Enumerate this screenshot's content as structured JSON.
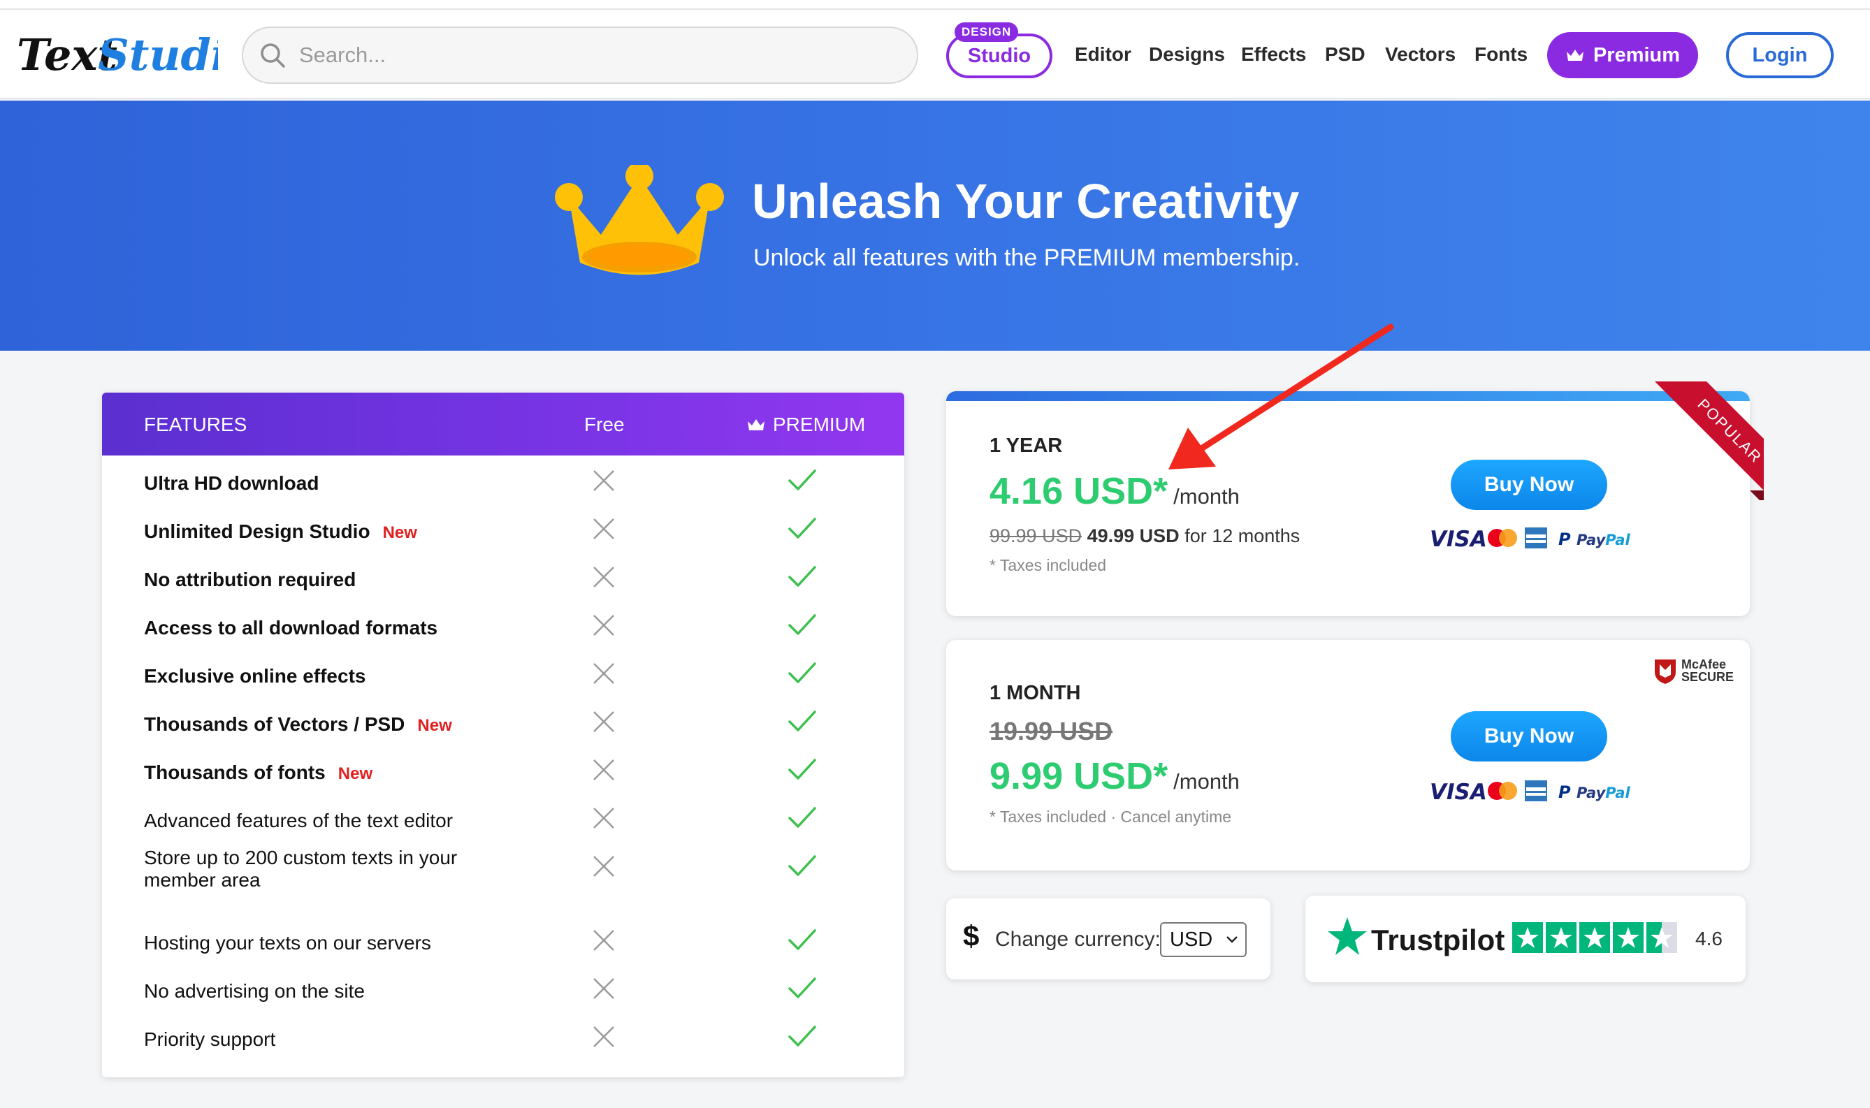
{
  "header": {
    "logo_text": "TextStudio",
    "search_placeholder": "Search...",
    "studio_badge": "DESIGN",
    "studio_label": "Studio",
    "nav": [
      "Editor",
      "Designs",
      "Effects",
      "PSD",
      "Vectors",
      "Fonts"
    ],
    "premium_label": "Premium",
    "login_label": "Login"
  },
  "hero": {
    "title": "Unleash Your Creativity",
    "subtitle": "Unlock all features with the PREMIUM membership."
  },
  "features": {
    "col_features": "FEATURES",
    "col_free": "Free",
    "col_premium": "PREMIUM",
    "rows": [
      {
        "label": "Ultra HD download",
        "new": ""
      },
      {
        "label": "Unlimited Design Studio",
        "new": "New"
      },
      {
        "label": "No attribution required",
        "new": ""
      },
      {
        "label": "Access to all download formats",
        "new": ""
      },
      {
        "label": "Exclusive online effects",
        "new": ""
      },
      {
        "label": "Thousands of Vectors / PSD",
        "new": "New"
      },
      {
        "label": "Thousands of fonts",
        "new": "New"
      },
      {
        "label": "Advanced features of the text editor",
        "new": ""
      },
      {
        "label": "Store up to 200 custom texts in your",
        "label2": "member area",
        "new": ""
      },
      {
        "label": "Hosting your texts on our servers",
        "new": ""
      },
      {
        "label": "No advertising on the site",
        "new": ""
      },
      {
        "label": "Priority support",
        "new": ""
      }
    ]
  },
  "plans": {
    "year": {
      "title": "1 YEAR",
      "price": "4.16 USD*",
      "per": "/month",
      "old_price": "99.99 USD",
      "new_total": "49.99 USD",
      "period_text": "for 12 months",
      "taxes": "* Taxes included",
      "buy_label": "Buy Now",
      "ribbon": "POPULAR"
    },
    "month": {
      "title": "1 MONTH",
      "old_price": "19.99 USD",
      "price": "9.99 USD*",
      "per": "/month",
      "taxes": "* Taxes included · Cancel anytime",
      "buy_label": "Buy Now",
      "mcafee_line1": "McAfee",
      "mcafee_line2": "SECURE"
    },
    "payment": {
      "visa": "VISA",
      "paypal": "PayPal"
    }
  },
  "currency": {
    "symbol": "$",
    "label": "Change currency:",
    "selected": "USD"
  },
  "trustpilot": {
    "name": "Trustpilot",
    "score": "4.6",
    "rating": 4.6
  },
  "colors": {
    "accent_purple": "#8a2be2",
    "brand_blue": "#2a6ad6",
    "price_green": "#2ecc71",
    "new_red": "#e02020",
    "trust_green": "#00b67a"
  }
}
